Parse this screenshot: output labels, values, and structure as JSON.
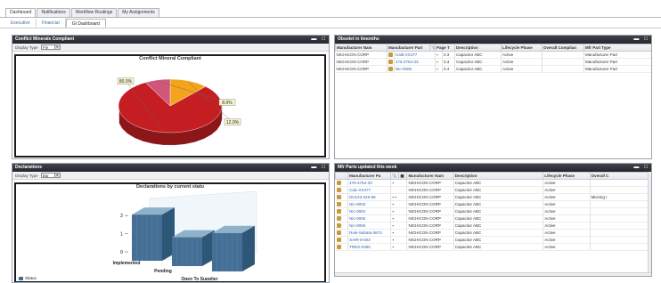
{
  "top_tabs": [
    "Dashboard",
    "Notifications",
    "Workflow Routings",
    "My Assignments"
  ],
  "sub_tabs": [
    "Executive",
    "Financial",
    "GI Dashboard"
  ],
  "panel1": {
    "title": "Conflict Minerals Compliant",
    "display_type_label": "Display Type",
    "display_type_value": "Pie",
    "chart_data": {
      "type": "pie",
      "title": "Conflict Mineral Compliant",
      "slices": [
        {
          "label": "80.0%",
          "value": 80,
          "color": "#c41e22"
        },
        {
          "label": "8.0%",
          "value": 8,
          "color": "#d0567a"
        },
        {
          "label": "12.0%",
          "value": 12,
          "color": "#f3a41c"
        }
      ]
    }
  },
  "panel2": {
    "title": "Obsolet in 6months",
    "columns": [
      "Manufacturer Nam",
      "Manufacturer Part",
      "",
      "",
      "Page T",
      "Description",
      "Lifecycle Phase",
      "Overall Complian",
      "Mfr Part Type"
    ],
    "rows": [
      [
        "NICHICON CORP",
        "",
        "Cald-XX477",
        "",
        "▪",
        "0.3",
        "Capacitor ABC",
        "Active",
        "",
        "Manufacturer Part"
      ],
      [
        "NICHICON CORP",
        "",
        "476-4764-33",
        "",
        "▪",
        "0.3",
        "Capacitor ABC",
        "Active",
        "",
        "Manufacturer Part"
      ],
      [
        "NICHICON CORP",
        "",
        "Nic-0005",
        "",
        "▪",
        "0.4",
        "Capacitor ABC",
        "Active",
        "",
        "Manufacturer Part"
      ]
    ]
  },
  "panel3": {
    "title": "Declarations",
    "display_type_label": "Display Type",
    "display_type_value": "Bar",
    "legend": "Status",
    "chart_data": {
      "type": "bar",
      "title": "Declarations by current statu",
      "categories": [
        "Implemented",
        "Pending",
        "Open To Supplier"
      ],
      "values": [
        2.4,
        1.5,
        2.0
      ],
      "ylim": [
        0,
        2.5
      ],
      "yticks": [
        "2",
        "1",
        "0"
      ]
    }
  },
  "panel4": {
    "title": "Mfr Parts updated this week",
    "columns": [
      "",
      "Manufacturer Pa",
      "",
      "Manufacturer Nam",
      "Description",
      "Lifecycle Phase",
      "Overall C"
    ],
    "rows": [
      [
        "",
        "476-4764-33",
        "▪",
        "NICHICON CORP",
        "Capacitor ABC",
        "Active",
        ""
      ],
      [
        "",
        "Calc-XX477",
        "",
        "NICHICON CORP",
        "Capacitor ABC",
        "Active",
        ""
      ],
      [
        "",
        "DU123-345-66",
        "▪ ▪",
        "NICHICON CORP",
        "Capacitor ABC",
        "Active",
        "Missing I"
      ],
      [
        "",
        "Nic-0003",
        "▪",
        "NICHICON CORP",
        "Capacitor ABC",
        "Active",
        ""
      ],
      [
        "",
        "Nic-0004",
        "▪",
        "NICHICON CORP",
        "Capacitor ABC",
        "Active",
        ""
      ],
      [
        "",
        "Nic-0005",
        "▪",
        "NICHICON CORP",
        "Capacitor ABC",
        "Active",
        ""
      ],
      [
        "",
        "Nic-0006",
        "▪",
        "NICHICON CORP",
        "Capacitor ABC",
        "Active",
        ""
      ],
      [
        "",
        "Rule-Sabata-3673",
        "▪",
        "NICHICON CORP",
        "Capacitor ABC",
        "Active",
        ""
      ],
      [
        "",
        "SAIR-8-003",
        "▪",
        "NICHICON CORP",
        "Capacitor ABC",
        "Active",
        ""
      ],
      [
        "",
        "TRES-0390",
        "▪",
        "NICHICON CORP",
        "Capacitor ABC",
        "Active",
        ""
      ]
    ]
  }
}
